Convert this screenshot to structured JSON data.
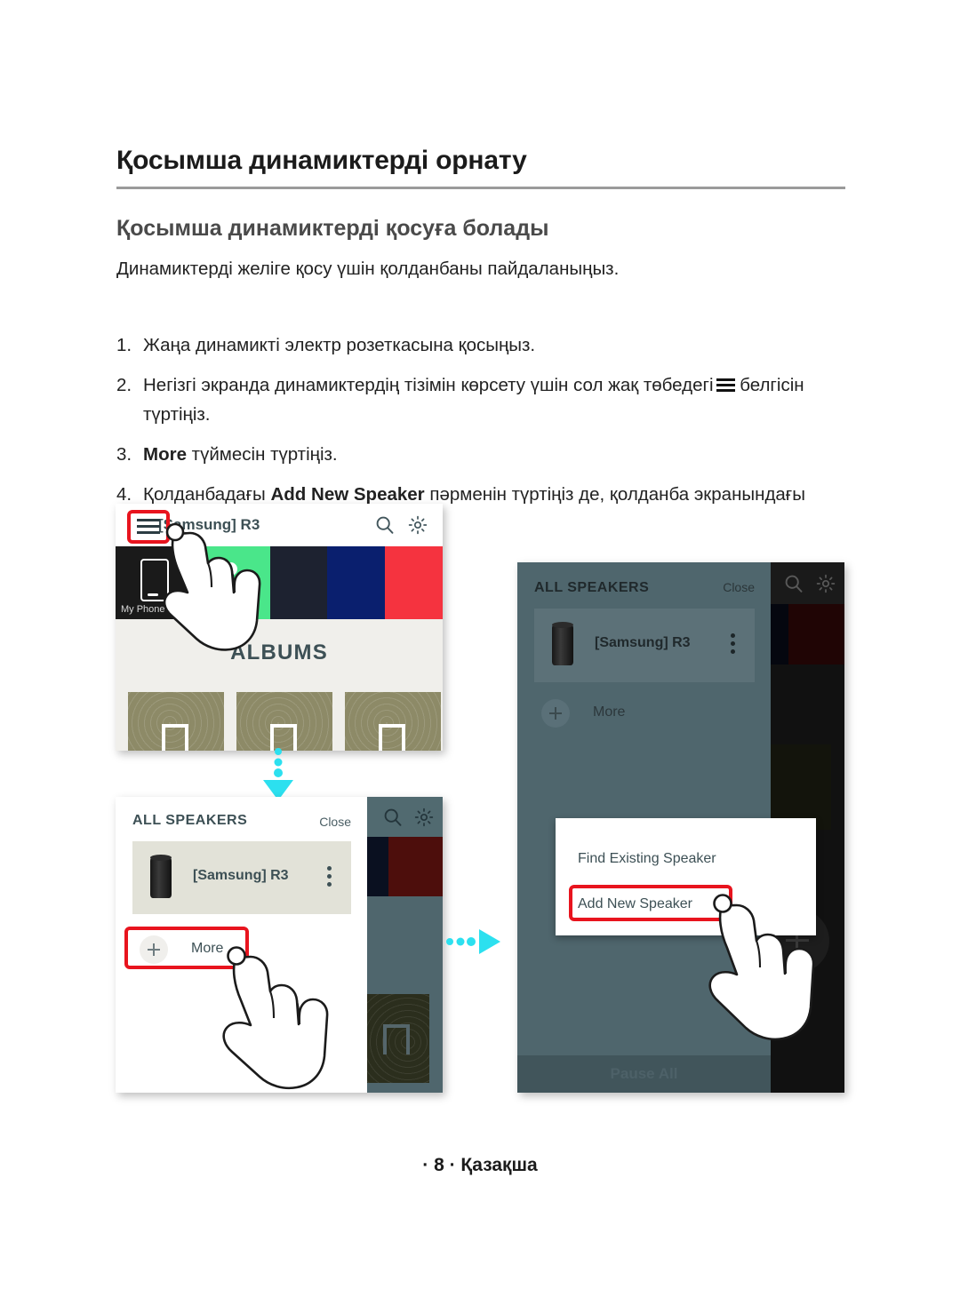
{
  "document": {
    "title": "Қосымша динамиктерді орнату",
    "subtitle": "Қосымша динамиктерді қосуға болады",
    "intro": "Динамиктерді желіге қосу үшін қолданбаны пайдаланыңыз.",
    "footer": "· 8 · Қазақша"
  },
  "steps": [
    {
      "num": "1.",
      "text_before": "Жаңа динамикті электр розеткасына қосыңыз.",
      "bold": "",
      "text_after": "",
      "has_hamburger_glyph": false
    },
    {
      "num": "2.",
      "text_before": "Негізгі экранда динамиктердің тізімін көрсету үшін сол жақ төбедегі",
      "bold": "",
      "text_after": "белгісін түртіңіз.",
      "has_hamburger_glyph": true
    },
    {
      "num": "3.",
      "text_before": "",
      "bold": "More",
      "text_after": " түймесін түртіңіз.",
      "has_hamburger_glyph": false
    },
    {
      "num": "4.",
      "text_before": "Қолданбадағы ",
      "bold": "Add New Speaker",
      "text_after": " пәрменін түртіңіз де, қолданба экранындағы нұсқауларды орындаңыз.",
      "has_hamburger_glyph": false
    }
  ],
  "mockups": {
    "home_screen": {
      "app_title": "[Samsung] R3",
      "menu_icon": "hamburger-icon",
      "search_icon": "search-icon",
      "settings_icon": "gear-icon",
      "tiles": [
        {
          "label": "My Phone",
          "color": "#1a1a1a"
        },
        {
          "label": "",
          "color": "#4ae68a"
        },
        {
          "label": "",
          "color": "#1d2230"
        },
        {
          "label": "",
          "color": "#0a1f6e"
        },
        {
          "label": "",
          "color": "#f5333f"
        }
      ],
      "albums_label": "ALBUMS",
      "album_tile_color": "#8d8a67",
      "highlight_color": "#e8141e"
    },
    "all_speakers_panel": {
      "heading": "ALL SPEAKERS",
      "close_label": "Close",
      "speaker_name": "[Samsung] R3",
      "more_label": "More",
      "kebab_icon": "kebab-menu-icon",
      "plus_icon": "plus-icon",
      "search_icon": "search-icon",
      "settings_icon": "gear-icon",
      "highlight_color": "#e8141e"
    },
    "add_speaker_dialog": {
      "heading": "ALL SPEAKERS",
      "close_label": "Close",
      "speaker_name": "[Samsung] R3",
      "more_label": "More",
      "pause_all_label": "Pause All",
      "side_more_label": "More",
      "dialog_items": [
        {
          "label": "Find Existing Speaker",
          "highlighted": false
        },
        {
          "label": "Add New Speaker",
          "highlighted": true
        }
      ],
      "highlight_color": "#e8141e"
    }
  },
  "arrows": {
    "down": {
      "color": "#2ce0ef",
      "direction": "down"
    },
    "right": {
      "color": "#2ce0ef",
      "direction": "right"
    }
  }
}
